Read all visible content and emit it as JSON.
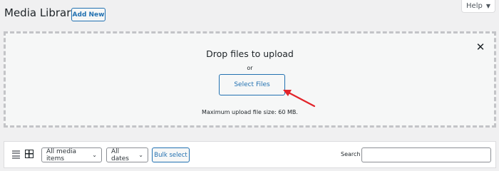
{
  "help": {
    "label": "Help",
    "caret": "▼"
  },
  "header": {
    "title": "Media Library",
    "add_new_label": "Add New"
  },
  "uploader": {
    "drop_title": "Drop files to upload",
    "or_text": "or",
    "select_files_label": "Select Files",
    "max_size_text": "Maximum upload file size: 60 MB.",
    "close_icon": "close-icon",
    "close_glyph": "✕"
  },
  "annotation": {
    "arrow_color": "#e2242a"
  },
  "toolbar": {
    "media_type_filter": {
      "selected": "All media items"
    },
    "date_filter": {
      "selected": "All dates"
    },
    "bulk_select_label": "Bulk select",
    "search_label": "Search",
    "search_value": "",
    "view_icons": [
      "list-view-icon",
      "grid-view-icon"
    ]
  },
  "colors": {
    "accent": "#2271b1",
    "background": "#f0f0f1",
    "dashed_border": "#c3c4c7"
  }
}
